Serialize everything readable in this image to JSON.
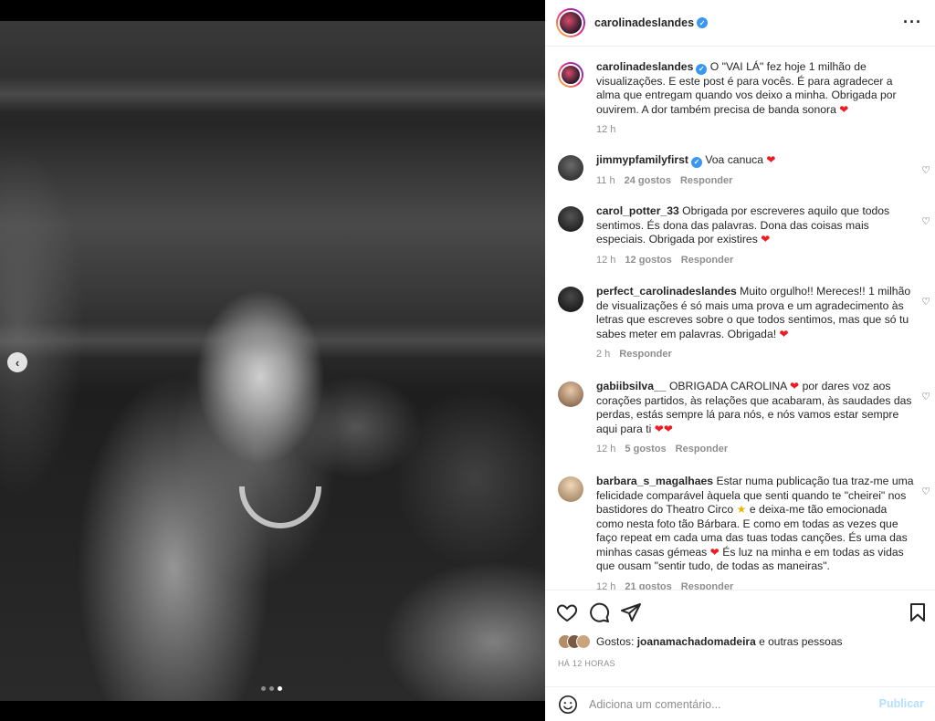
{
  "post": {
    "username": "carolinadeslandes",
    "more_icon": "more-horizontal-icon",
    "caption_prefix": "O \"VAI LÁ\" fez hoje 1 milhão de visualizações. E este post é para vocês. É para agradecer a alma que entregam quando vos deixo a minha. Obrigada por ouvirem. A dor também precisa de banda sonora",
    "caption_time": "12 h",
    "carousel": {
      "total": 3,
      "active": 3,
      "prev_icon": "chevron-left-icon"
    }
  },
  "comments": [
    {
      "user": "jimmypfamilyfirst",
      "verified": true,
      "text": "Voa canuca",
      "emoji": "❤",
      "time": "11 h",
      "likes": "24 gostos",
      "reply": "Responder"
    },
    {
      "user": "carol_potter_33",
      "text": "Obrigada por escreveres aquilo que todos sentimos. És dona das palavras. Dona das coisas mais especiais. Obrigada por existires",
      "emoji": "❤",
      "time": "12 h",
      "likes": "12 gostos",
      "reply": "Responder"
    },
    {
      "user": "perfect_carolinadeslandes",
      "text": "Muito orgulho!! Mereces!! 1 milhão de visualizações é só mais uma prova e um agradecimento às letras que escreves sobre o que todos sentimos, mas que só tu sabes meter em palavras. Obrigada!",
      "emoji": "❤",
      "time": "2 h",
      "reply": "Responder"
    },
    {
      "user": "gabiibsilva__",
      "text_a": "OBRIGADA CAROLINA",
      "text_b": "por dares voz aos corações partidos, às relações que acabaram, às saudades das perdas, estás sempre lá para nós, e nós vamos estar sempre aqui para ti",
      "emoji": "❤",
      "time": "12 h",
      "likes": "5 gostos",
      "reply": "Responder"
    },
    {
      "user": "barbara_s_magalhaes",
      "text_a": "Estar numa publicação tua traz-me uma felicidade comparável àquela que senti quando te \"cheirei\" nos bastidores do Theatro Circo",
      "star": "★",
      "text_b": "e deixa-me tão emocionada como nesta foto tão Bárbara. E como em todas as vezes que faço repeat em cada uma das tuas todas canções. És uma das minhas casas gémeas",
      "text_c": "És luz na minha e em todas as vidas que ousam \"sentir tudo, de todas as maneiras\".",
      "emoji": "❤",
      "time": "12 h",
      "likes": "21 gostos",
      "reply": "Responder"
    }
  ],
  "footer": {
    "likes_prefix": "Gostos:",
    "likes_user": "joanamachadomadeira",
    "likes_suffix": "e outras pessoas",
    "time_ago": "HÁ 12 HORAS",
    "comment_placeholder": "Adiciona um comentário...",
    "publish_label": "Publicar"
  },
  "colors": {
    "verified": "#3897f0",
    "heart": "#ed1c24",
    "publish": "#b2dffc"
  }
}
